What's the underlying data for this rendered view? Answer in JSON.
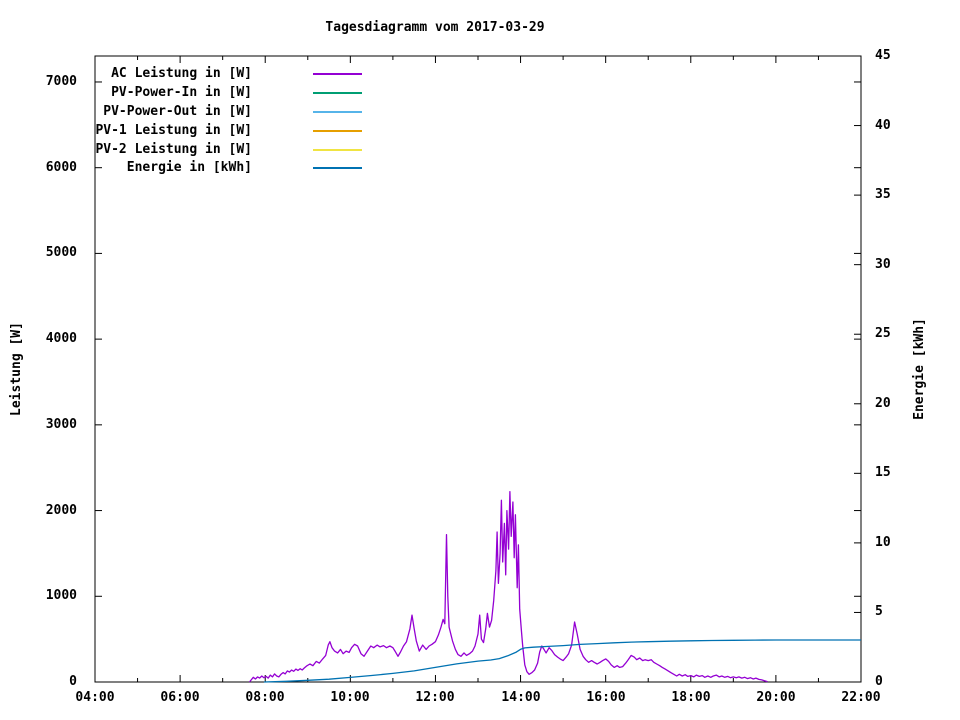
{
  "title": "Tagesdiagramm vom 2017-03-29",
  "chart_data": {
    "type": "line",
    "title": "Tagesdiagramm vom 2017-03-29",
    "ylabel": "Leistung [W]",
    "y2label": "Energie [kWh]",
    "xlabel": "",
    "xlim_hours": [
      4,
      22
    ],
    "ylim": [
      0,
      7303
    ],
    "y2lim": [
      0,
      45
    ],
    "grid": false,
    "legend_position": "top-left-inside",
    "xticks": {
      "labels": [
        "04:00",
        "06:00",
        "08:00",
        "10:00",
        "12:00",
        "14:00",
        "16:00",
        "18:00",
        "20:00",
        "22:00"
      ],
      "hours": [
        4,
        6,
        8,
        10,
        12,
        14,
        16,
        18,
        20,
        22
      ]
    },
    "xminor_hours": [
      5,
      7,
      9,
      11,
      13,
      15,
      17,
      19,
      21
    ],
    "yticks": [
      0,
      1000,
      2000,
      3000,
      4000,
      5000,
      6000,
      7000
    ],
    "y2ticks": [
      0,
      5,
      10,
      15,
      20,
      25,
      30,
      35,
      40,
      45
    ],
    "series": [
      {
        "name": "AC Leistung in [W]",
        "color": "#9400d3",
        "axis": "y1",
        "points": [
          [
            7.63,
            0
          ],
          [
            7.67,
            25
          ],
          [
            7.72,
            55
          ],
          [
            7.77,
            35
          ],
          [
            7.82,
            60
          ],
          [
            7.87,
            45
          ],
          [
            7.92,
            70
          ],
          [
            7.97,
            50
          ],
          [
            8.02,
            65
          ],
          [
            8.07,
            45
          ],
          [
            8.12,
            80
          ],
          [
            8.17,
            60
          ],
          [
            8.22,
            95
          ],
          [
            8.27,
            70
          ],
          [
            8.32,
            60
          ],
          [
            8.37,
            90
          ],
          [
            8.42,
            110
          ],
          [
            8.47,
            95
          ],
          [
            8.52,
            130
          ],
          [
            8.57,
            115
          ],
          [
            8.62,
            140
          ],
          [
            8.67,
            125
          ],
          [
            8.72,
            150
          ],
          [
            8.77,
            135
          ],
          [
            8.82,
            155
          ],
          [
            8.87,
            140
          ],
          [
            8.92,
            165
          ],
          [
            8.97,
            185
          ],
          [
            9.05,
            210
          ],
          [
            9.12,
            190
          ],
          [
            9.2,
            240
          ],
          [
            9.27,
            220
          ],
          [
            9.35,
            270
          ],
          [
            9.42,
            310
          ],
          [
            9.48,
            430
          ],
          [
            9.52,
            470
          ],
          [
            9.57,
            400
          ],
          [
            9.63,
            360
          ],
          [
            9.7,
            340
          ],
          [
            9.77,
            380
          ],
          [
            9.83,
            330
          ],
          [
            9.9,
            360
          ],
          [
            9.97,
            345
          ],
          [
            10.03,
            400
          ],
          [
            10.1,
            440
          ],
          [
            10.17,
            420
          ],
          [
            10.25,
            330
          ],
          [
            10.32,
            300
          ],
          [
            10.4,
            360
          ],
          [
            10.48,
            420
          ],
          [
            10.55,
            400
          ],
          [
            10.63,
            430
          ],
          [
            10.7,
            410
          ],
          [
            10.78,
            425
          ],
          [
            10.85,
            400
          ],
          [
            10.93,
            420
          ],
          [
            11.0,
            400
          ],
          [
            11.05,
            360
          ],
          [
            11.12,
            300
          ],
          [
            11.18,
            350
          ],
          [
            11.25,
            420
          ],
          [
            11.32,
            470
          ],
          [
            11.4,
            620
          ],
          [
            11.45,
            780
          ],
          [
            11.5,
            620
          ],
          [
            11.55,
            480
          ],
          [
            11.62,
            360
          ],
          [
            11.7,
            430
          ],
          [
            11.78,
            380
          ],
          [
            11.85,
            420
          ],
          [
            11.92,
            440
          ],
          [
            12.0,
            470
          ],
          [
            12.07,
            550
          ],
          [
            12.13,
            640
          ],
          [
            12.18,
            730
          ],
          [
            12.22,
            680
          ],
          [
            12.26,
            1720
          ],
          [
            12.29,
            1000
          ],
          [
            12.32,
            640
          ],
          [
            12.4,
            480
          ],
          [
            12.47,
            380
          ],
          [
            12.53,
            320
          ],
          [
            12.6,
            300
          ],
          [
            12.67,
            340
          ],
          [
            12.73,
            310
          ],
          [
            12.8,
            330
          ],
          [
            12.87,
            360
          ],
          [
            12.93,
            420
          ],
          [
            13.0,
            560
          ],
          [
            13.04,
            780
          ],
          [
            13.08,
            500
          ],
          [
            13.13,
            460
          ],
          [
            13.18,
            620
          ],
          [
            13.22,
            800
          ],
          [
            13.27,
            640
          ],
          [
            13.32,
            720
          ],
          [
            13.37,
            950
          ],
          [
            13.42,
            1300
          ],
          [
            13.45,
            1750
          ],
          [
            13.48,
            1150
          ],
          [
            13.52,
            1500
          ],
          [
            13.55,
            2120
          ],
          [
            13.58,
            1400
          ],
          [
            13.62,
            1850
          ],
          [
            13.65,
            1250
          ],
          [
            13.68,
            2000
          ],
          [
            13.72,
            1550
          ],
          [
            13.75,
            2220
          ],
          [
            13.78,
            1700
          ],
          [
            13.82,
            2100
          ],
          [
            13.85,
            1450
          ],
          [
            13.88,
            1950
          ],
          [
            13.92,
            1100
          ],
          [
            13.95,
            1600
          ],
          [
            13.98,
            850
          ],
          [
            14.02,
            600
          ],
          [
            14.05,
            420
          ],
          [
            14.1,
            200
          ],
          [
            14.15,
            120
          ],
          [
            14.2,
            90
          ],
          [
            14.27,
            110
          ],
          [
            14.33,
            140
          ],
          [
            14.4,
            220
          ],
          [
            14.45,
            350
          ],
          [
            14.5,
            420
          ],
          [
            14.55,
            380
          ],
          [
            14.6,
            340
          ],
          [
            14.67,
            400
          ],
          [
            14.73,
            370
          ],
          [
            14.8,
            320
          ],
          [
            14.87,
            290
          ],
          [
            14.93,
            270
          ],
          [
            15.0,
            250
          ],
          [
            15.07,
            290
          ],
          [
            15.13,
            330
          ],
          [
            15.2,
            430
          ],
          [
            15.27,
            700
          ],
          [
            15.33,
            560
          ],
          [
            15.4,
            380
          ],
          [
            15.47,
            300
          ],
          [
            15.53,
            260
          ],
          [
            15.6,
            230
          ],
          [
            15.67,
            250
          ],
          [
            15.73,
            230
          ],
          [
            15.8,
            210
          ],
          [
            15.87,
            230
          ],
          [
            15.93,
            250
          ],
          [
            16.0,
            270
          ],
          [
            16.07,
            240
          ],
          [
            16.13,
            200
          ],
          [
            16.2,
            170
          ],
          [
            16.27,
            190
          ],
          [
            16.33,
            170
          ],
          [
            16.4,
            180
          ],
          [
            16.47,
            220
          ],
          [
            16.53,
            260
          ],
          [
            16.6,
            310
          ],
          [
            16.67,
            290
          ],
          [
            16.73,
            260
          ],
          [
            16.8,
            280
          ],
          [
            16.87,
            250
          ],
          [
            16.93,
            260
          ],
          [
            17.0,
            250
          ],
          [
            17.07,
            260
          ],
          [
            17.13,
            230
          ],
          [
            17.2,
            210
          ],
          [
            17.27,
            190
          ],
          [
            17.33,
            170
          ],
          [
            17.4,
            150
          ],
          [
            17.47,
            130
          ],
          [
            17.53,
            110
          ],
          [
            17.6,
            90
          ],
          [
            17.67,
            70
          ],
          [
            17.73,
            90
          ],
          [
            17.8,
            70
          ],
          [
            17.87,
            85
          ],
          [
            17.93,
            65
          ],
          [
            18.0,
            75
          ],
          [
            18.07,
            60
          ],
          [
            18.13,
            80
          ],
          [
            18.2,
            65
          ],
          [
            18.27,
            75
          ],
          [
            18.33,
            55
          ],
          [
            18.4,
            70
          ],
          [
            18.47,
            55
          ],
          [
            18.53,
            70
          ],
          [
            18.6,
            80
          ],
          [
            18.67,
            60
          ],
          [
            18.73,
            70
          ],
          [
            18.8,
            55
          ],
          [
            18.87,
            65
          ],
          [
            18.93,
            50
          ],
          [
            19.0,
            60
          ],
          [
            19.07,
            50
          ],
          [
            19.13,
            60
          ],
          [
            19.2,
            45
          ],
          [
            19.27,
            55
          ],
          [
            19.33,
            40
          ],
          [
            19.4,
            50
          ],
          [
            19.47,
            35
          ],
          [
            19.53,
            45
          ],
          [
            19.6,
            30
          ],
          [
            19.67,
            25
          ],
          [
            19.73,
            15
          ],
          [
            19.8,
            5
          ]
        ]
      },
      {
        "name": "PV-Power-In in [W]",
        "color": "#009e73",
        "axis": "y1",
        "points": []
      },
      {
        "name": "PV-Power-Out in [W]",
        "color": "#56b4e9",
        "axis": "y1",
        "points": []
      },
      {
        "name": "PV-1 Leistung in [W]",
        "color": "#e69f00",
        "axis": "y1",
        "points": []
      },
      {
        "name": "PV-2 Leistung in [W]",
        "color": "#f0e442",
        "axis": "y1",
        "points": []
      },
      {
        "name": "Energie in [kWh]",
        "color": "#0072b2",
        "axis": "y2",
        "points": [
          [
            7.97,
            0
          ],
          [
            8.5,
            0.05
          ],
          [
            9.0,
            0.12
          ],
          [
            9.5,
            0.2
          ],
          [
            10.0,
            0.33
          ],
          [
            10.5,
            0.47
          ],
          [
            11.0,
            0.62
          ],
          [
            11.5,
            0.8
          ],
          [
            12.0,
            1.05
          ],
          [
            12.5,
            1.3
          ],
          [
            13.0,
            1.5
          ],
          [
            13.3,
            1.58
          ],
          [
            13.5,
            1.68
          ],
          [
            13.7,
            1.88
          ],
          [
            13.9,
            2.15
          ],
          [
            14.0,
            2.35
          ],
          [
            14.1,
            2.45
          ],
          [
            14.3,
            2.5
          ],
          [
            14.6,
            2.55
          ],
          [
            15.0,
            2.62
          ],
          [
            15.4,
            2.7
          ],
          [
            15.8,
            2.76
          ],
          [
            16.2,
            2.82
          ],
          [
            16.6,
            2.87
          ],
          [
            17.0,
            2.9
          ],
          [
            17.5,
            2.93
          ],
          [
            18.0,
            2.96
          ],
          [
            18.5,
            2.98
          ],
          [
            19.0,
            3.0
          ],
          [
            19.5,
            3.01
          ],
          [
            20.0,
            3.02
          ],
          [
            21.0,
            3.02
          ],
          [
            22.0,
            3.02
          ]
        ]
      }
    ]
  }
}
